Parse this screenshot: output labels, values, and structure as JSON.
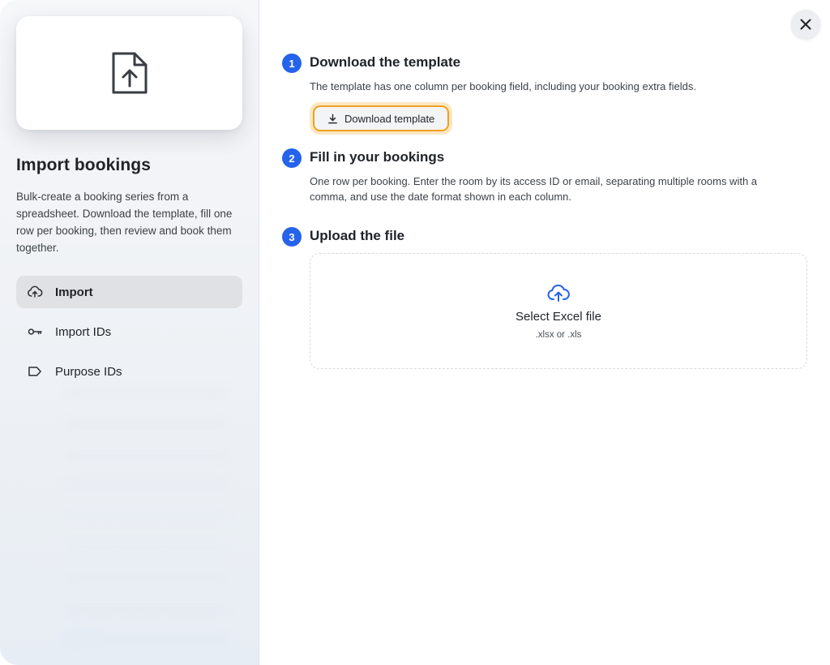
{
  "sidebar": {
    "title": "Import bookings",
    "description": "Bulk-create a booking series from a spreadsheet. Download the template, fill one row per booking, then review and book them together.",
    "nav": [
      {
        "label": "Import",
        "icon": "cloud-upload-icon",
        "active": true
      },
      {
        "label": "Import IDs",
        "icon": "key-icon",
        "active": false
      },
      {
        "label": "Purpose IDs",
        "icon": "tag-icon",
        "active": false
      }
    ]
  },
  "steps": [
    {
      "number": "1",
      "title": "Download the template",
      "description": "The template has one column per booking field, including your booking extra fields.",
      "button_label": "Download template"
    },
    {
      "number": "2",
      "title": "Fill in your bookings",
      "description": "One row per booking. Enter the room by its access ID or email, separating multiple rooms with a comma, and use the date format shown in each column."
    },
    {
      "number": "3",
      "title": "Upload the file"
    }
  ],
  "dropzone": {
    "title": "Select Excel file",
    "hint": ".xlsx or .xls"
  },
  "colors": {
    "accent": "#2563eb",
    "focus_ring": "#f0a020"
  }
}
